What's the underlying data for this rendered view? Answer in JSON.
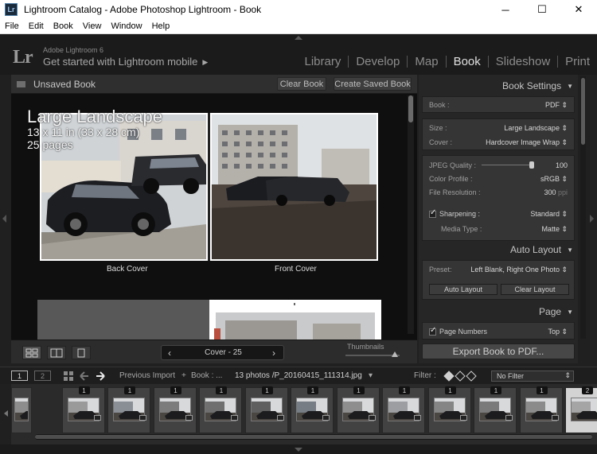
{
  "window": {
    "app_icon": "Lr",
    "title": "Lightroom Catalog - Adobe Photoshop Lightroom - Book",
    "minimize": "─",
    "maximize": "☐",
    "close": "✕"
  },
  "menu": [
    "File",
    "Edit",
    "Book",
    "View",
    "Window",
    "Help"
  ],
  "identity": {
    "logo": "Lr",
    "product": "Adobe Lightroom 6",
    "tagline": "Get started with Lightroom mobile"
  },
  "modules": [
    {
      "label": "Library",
      "active": false
    },
    {
      "label": "Develop",
      "active": false
    },
    {
      "label": "Map",
      "active": false
    },
    {
      "label": "Book",
      "active": true
    },
    {
      "label": "Slideshow",
      "active": false
    },
    {
      "label": "Print",
      "active": false
    }
  ],
  "center": {
    "book_title": "Unsaved Book",
    "clear_button": "Clear Book",
    "create_button": "Create Saved Book",
    "size_title": "Large Landscape",
    "size_dims": "13 x 11 in (33 x 28 cm)",
    "pages_count": "25 pages",
    "back_caption": "Back Cover",
    "front_caption": "Front Cover",
    "page_nav_label": "Cover - 25",
    "thumbnails_label": "Thumbnails"
  },
  "panel": {
    "book_settings_title": "Book Settings",
    "book_label": "Book :",
    "book_value": "PDF ⇕",
    "size_label": "Size :",
    "size_value": "Large Landscape ⇕",
    "cover_label": "Cover :",
    "cover_value": "Hardcover Image Wrap ⇕",
    "jpeg_label": "JPEG Quality :",
    "jpeg_value": "100",
    "jpeg_quality": 100,
    "profile_label": "Color Profile :",
    "profile_value": "sRGB ⇕",
    "resolution_label": "File Resolution :",
    "resolution_value": "300",
    "resolution_unit": "ppi",
    "sharpening_label": "Sharpening :",
    "sharpening_value": "Standard ⇕",
    "media_label": "Media Type :",
    "media_value": "Matte ⇕",
    "auto_layout_title": "Auto Layout",
    "preset_label": "Preset:",
    "preset_value": "Left Blank, Right One Photo ⇕",
    "auto_layout_button": "Auto Layout",
    "clear_layout_button": "Clear Layout",
    "page_title": "Page",
    "page_numbers_label": "Page Numbers",
    "page_numbers_value": "Top ⇕",
    "export_button": "Export Book to PDF..."
  },
  "filmbar": {
    "screen1": "1",
    "screen2": "2",
    "source": "Previous Import",
    "plus": "+",
    "book_crumb": "Book : ...",
    "photo_count": "13 photos /P_20160415_111314.jpg",
    "filter_label": "Filter :",
    "filter_value": "No Filter"
  },
  "filmstrip": [
    {
      "badge": "",
      "sel": false
    },
    {
      "badge": "1",
      "sel": false
    },
    {
      "badge": "1",
      "sel": false
    },
    {
      "badge": "1",
      "sel": false
    },
    {
      "badge": "1",
      "sel": false
    },
    {
      "badge": "1",
      "sel": false
    },
    {
      "badge": "1",
      "sel": false
    },
    {
      "badge": "1",
      "sel": false
    },
    {
      "badge": "1",
      "sel": false
    },
    {
      "badge": "1",
      "sel": false
    },
    {
      "badge": "1",
      "sel": false
    },
    {
      "badge": "1",
      "sel": false
    },
    {
      "badge": "2",
      "sel": true
    }
  ],
  "colors": {
    "background": "#202020",
    "panel": "#262626",
    "accent_active": "#e0e0e0"
  }
}
